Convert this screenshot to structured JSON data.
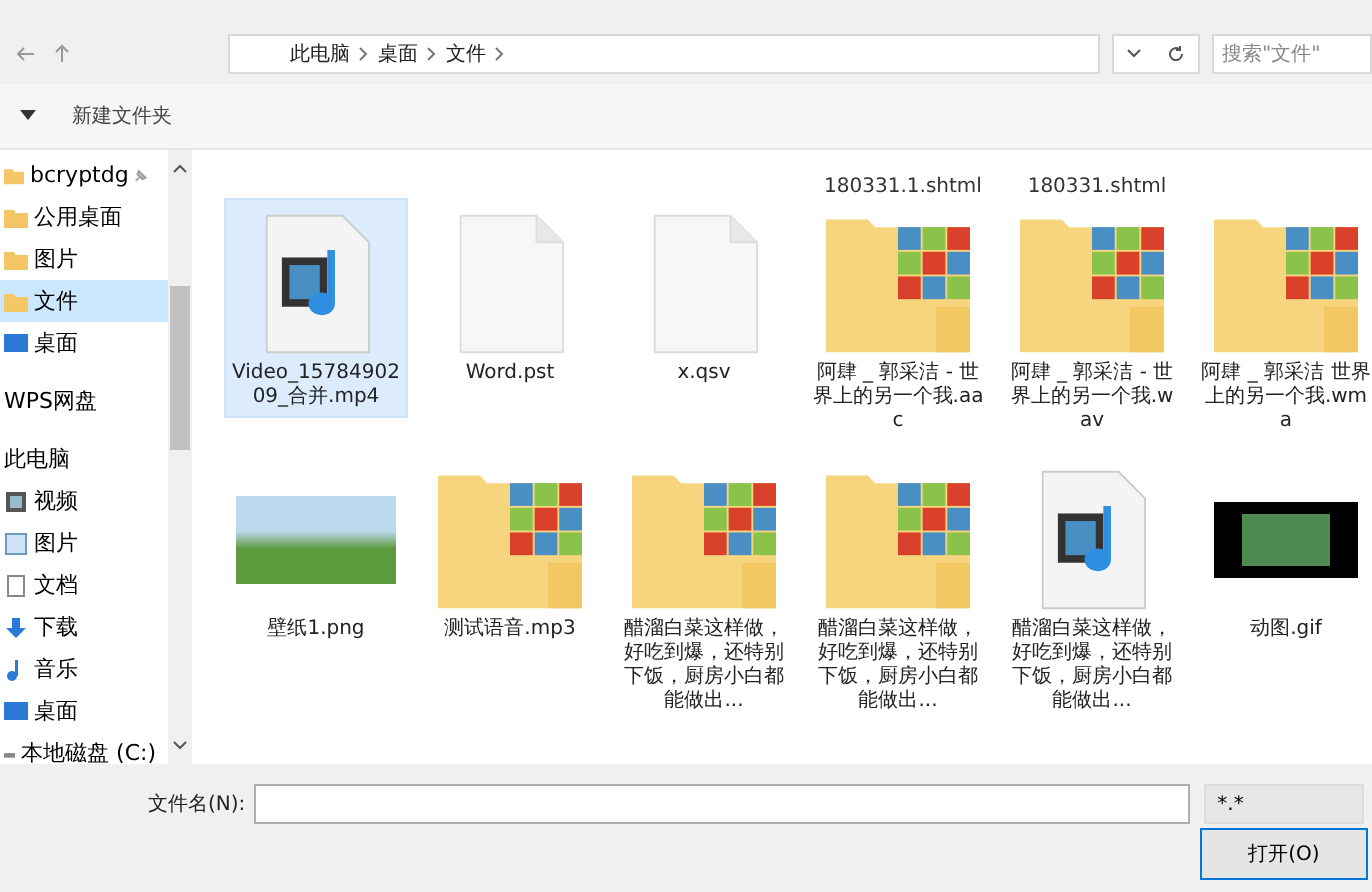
{
  "address_bar": {
    "crumbs": [
      "此电脑",
      "桌面",
      "文件"
    ]
  },
  "search": {
    "placeholder": "搜索\"文件\""
  },
  "toolbar": {
    "new_folder": "新建文件夹"
  },
  "sidebar": {
    "items": [
      {
        "label": "bcryptdg",
        "pinned": true,
        "selected": false
      },
      {
        "label": "公用桌面",
        "pinned": false,
        "selected": false
      },
      {
        "label": "图片",
        "pinned": false,
        "selected": false
      },
      {
        "label": "文件",
        "pinned": false,
        "selected": true
      },
      {
        "label": "桌面",
        "pinned": false,
        "selected": false
      },
      {
        "label": "WPS网盘",
        "pinned": false,
        "selected": false
      },
      {
        "label": "此电脑",
        "pinned": false,
        "selected": false
      },
      {
        "label": "视频",
        "pinned": false,
        "selected": false
      },
      {
        "label": "图片",
        "pinned": false,
        "selected": false
      },
      {
        "label": "文档",
        "pinned": false,
        "selected": false
      },
      {
        "label": "下载",
        "pinned": false,
        "selected": false
      },
      {
        "label": "音乐",
        "pinned": false,
        "selected": false
      },
      {
        "label": "桌面",
        "pinned": false,
        "selected": false
      },
      {
        "label": "本地磁盘 (C:)",
        "pinned": false,
        "selected": false
      }
    ]
  },
  "partial_row": [
    "180331.1.shtml",
    "180331.shtml"
  ],
  "files": [
    {
      "name": "Video_1578490209_合并.mp4",
      "kind": "media",
      "selected": true
    },
    {
      "name": "Word.pst",
      "kind": "blank",
      "selected": false
    },
    {
      "name": "x.qsv",
      "kind": "blank",
      "selected": false
    },
    {
      "name": "阿肆 _ 郭采洁 - 世界上的另一个我.aac",
      "kind": "folder",
      "selected": false
    },
    {
      "name": "阿肆 _ 郭采洁 - 世界上的另一个我.wav",
      "kind": "folder",
      "selected": false
    },
    {
      "name": "阿肆 _ 郭采洁 世界上的另一个我.wma",
      "kind": "folder",
      "selected": false
    },
    {
      "name": "壁纸1.png",
      "kind": "photo",
      "selected": false
    },
    {
      "name": "测试语音.mp3",
      "kind": "folder",
      "selected": false
    },
    {
      "name": "醋溜白菜这样做，好吃到爆，还特别下饭，厨房小白都能做出...",
      "kind": "folder",
      "selected": false
    },
    {
      "name": "醋溜白菜这样做，好吃到爆，还特别下饭，厨房小白都能做出...",
      "kind": "folder",
      "selected": false
    },
    {
      "name": "醋溜白菜这样做，好吃到爆，还特别下饭，厨房小白都能做出...",
      "kind": "media",
      "selected": false
    },
    {
      "name": "动图.gif",
      "kind": "gif",
      "selected": false
    }
  ],
  "filename": {
    "label": "文件名(N):"
  },
  "filter": {
    "value": "*.*"
  },
  "open_button": "打开(O)"
}
